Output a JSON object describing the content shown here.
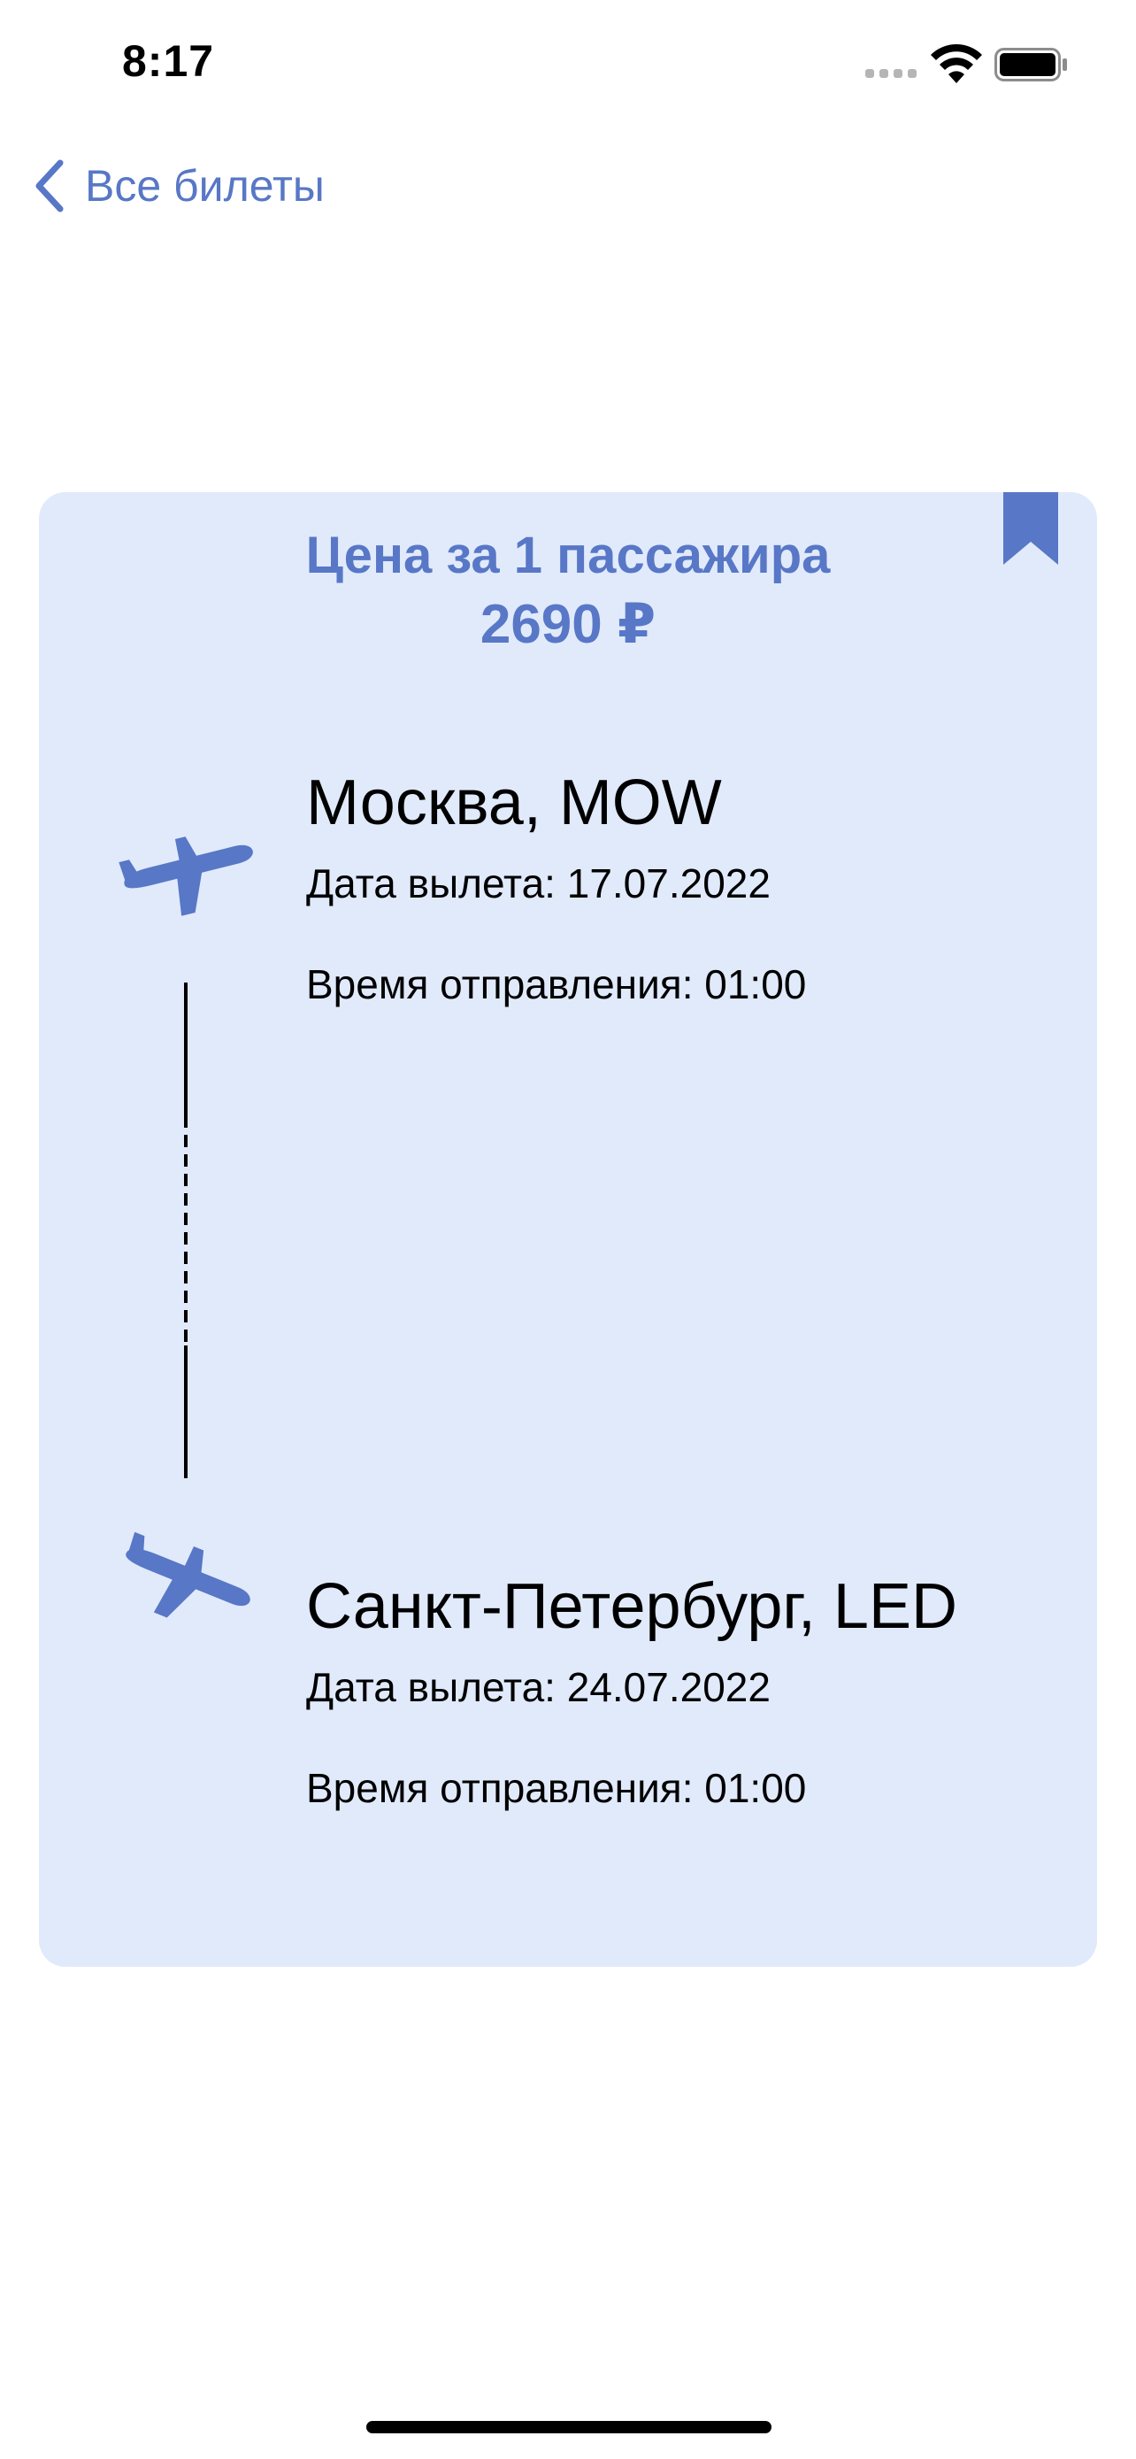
{
  "status_bar": {
    "time": "8:17",
    "icons": [
      "cellular-signal-icon",
      "wifi-icon",
      "battery-icon"
    ]
  },
  "nav": {
    "back_label": "Все билеты",
    "back_icon": "chevron-left-icon"
  },
  "colors": {
    "accent": "#5877c6",
    "card_background": "#e1eafb",
    "text": "#000000"
  },
  "ticket": {
    "bookmark_icon": "bookmark-icon",
    "price_label": "Цена за 1 пассажира",
    "price_value": "2690 ₽",
    "departure": {
      "icon": "airplane-takeoff-icon",
      "city": "Москва, MOW",
      "date_label": "Дата вылета:",
      "date": "17.07.2022",
      "time_label": "Время отправления:",
      "time": "01:00"
    },
    "arrival": {
      "icon": "airplane-landing-icon",
      "city": "Санкт-Петербург, LED",
      "date_label": "Дата вылета:",
      "date": "24.07.2022",
      "time_label": "Время отправления:",
      "time": "01:00"
    }
  }
}
